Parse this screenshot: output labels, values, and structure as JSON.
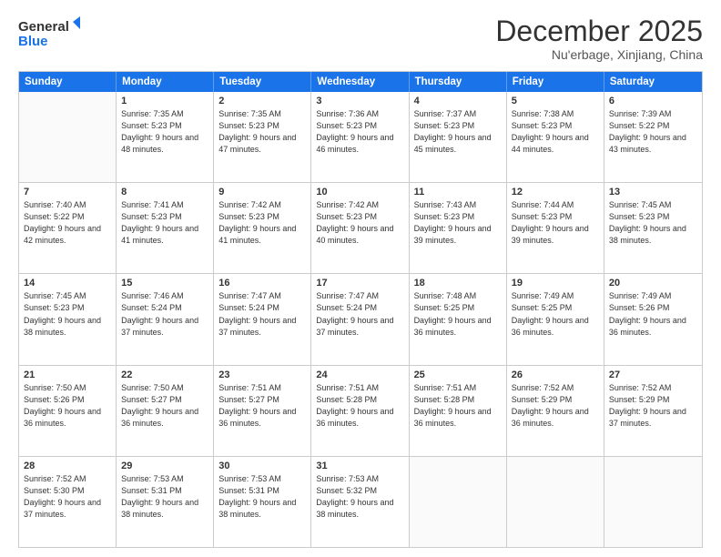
{
  "logo": {
    "line1": "General",
    "line2": "Blue"
  },
  "header": {
    "month": "December 2025",
    "location": "Nu'erbage, Xinjiang, China"
  },
  "weekdays": [
    "Sunday",
    "Monday",
    "Tuesday",
    "Wednesday",
    "Thursday",
    "Friday",
    "Saturday"
  ],
  "rows": [
    [
      {
        "day": "",
        "sunrise": "",
        "sunset": "",
        "daylight": ""
      },
      {
        "day": "1",
        "sunrise": "Sunrise: 7:35 AM",
        "sunset": "Sunset: 5:23 PM",
        "daylight": "Daylight: 9 hours and 48 minutes."
      },
      {
        "day": "2",
        "sunrise": "Sunrise: 7:35 AM",
        "sunset": "Sunset: 5:23 PM",
        "daylight": "Daylight: 9 hours and 47 minutes."
      },
      {
        "day": "3",
        "sunrise": "Sunrise: 7:36 AM",
        "sunset": "Sunset: 5:23 PM",
        "daylight": "Daylight: 9 hours and 46 minutes."
      },
      {
        "day": "4",
        "sunrise": "Sunrise: 7:37 AM",
        "sunset": "Sunset: 5:23 PM",
        "daylight": "Daylight: 9 hours and 45 minutes."
      },
      {
        "day": "5",
        "sunrise": "Sunrise: 7:38 AM",
        "sunset": "Sunset: 5:23 PM",
        "daylight": "Daylight: 9 hours and 44 minutes."
      },
      {
        "day": "6",
        "sunrise": "Sunrise: 7:39 AM",
        "sunset": "Sunset: 5:22 PM",
        "daylight": "Daylight: 9 hours and 43 minutes."
      }
    ],
    [
      {
        "day": "7",
        "sunrise": "Sunrise: 7:40 AM",
        "sunset": "Sunset: 5:22 PM",
        "daylight": "Daylight: 9 hours and 42 minutes."
      },
      {
        "day": "8",
        "sunrise": "Sunrise: 7:41 AM",
        "sunset": "Sunset: 5:23 PM",
        "daylight": "Daylight: 9 hours and 41 minutes."
      },
      {
        "day": "9",
        "sunrise": "Sunrise: 7:42 AM",
        "sunset": "Sunset: 5:23 PM",
        "daylight": "Daylight: 9 hours and 41 minutes."
      },
      {
        "day": "10",
        "sunrise": "Sunrise: 7:42 AM",
        "sunset": "Sunset: 5:23 PM",
        "daylight": "Daylight: 9 hours and 40 minutes."
      },
      {
        "day": "11",
        "sunrise": "Sunrise: 7:43 AM",
        "sunset": "Sunset: 5:23 PM",
        "daylight": "Daylight: 9 hours and 39 minutes."
      },
      {
        "day": "12",
        "sunrise": "Sunrise: 7:44 AM",
        "sunset": "Sunset: 5:23 PM",
        "daylight": "Daylight: 9 hours and 39 minutes."
      },
      {
        "day": "13",
        "sunrise": "Sunrise: 7:45 AM",
        "sunset": "Sunset: 5:23 PM",
        "daylight": "Daylight: 9 hours and 38 minutes."
      }
    ],
    [
      {
        "day": "14",
        "sunrise": "Sunrise: 7:45 AM",
        "sunset": "Sunset: 5:23 PM",
        "daylight": "Daylight: 9 hours and 38 minutes."
      },
      {
        "day": "15",
        "sunrise": "Sunrise: 7:46 AM",
        "sunset": "Sunset: 5:24 PM",
        "daylight": "Daylight: 9 hours and 37 minutes."
      },
      {
        "day": "16",
        "sunrise": "Sunrise: 7:47 AM",
        "sunset": "Sunset: 5:24 PM",
        "daylight": "Daylight: 9 hours and 37 minutes."
      },
      {
        "day": "17",
        "sunrise": "Sunrise: 7:47 AM",
        "sunset": "Sunset: 5:24 PM",
        "daylight": "Daylight: 9 hours and 37 minutes."
      },
      {
        "day": "18",
        "sunrise": "Sunrise: 7:48 AM",
        "sunset": "Sunset: 5:25 PM",
        "daylight": "Daylight: 9 hours and 36 minutes."
      },
      {
        "day": "19",
        "sunrise": "Sunrise: 7:49 AM",
        "sunset": "Sunset: 5:25 PM",
        "daylight": "Daylight: 9 hours and 36 minutes."
      },
      {
        "day": "20",
        "sunrise": "Sunrise: 7:49 AM",
        "sunset": "Sunset: 5:26 PM",
        "daylight": "Daylight: 9 hours and 36 minutes."
      }
    ],
    [
      {
        "day": "21",
        "sunrise": "Sunrise: 7:50 AM",
        "sunset": "Sunset: 5:26 PM",
        "daylight": "Daylight: 9 hours and 36 minutes."
      },
      {
        "day": "22",
        "sunrise": "Sunrise: 7:50 AM",
        "sunset": "Sunset: 5:27 PM",
        "daylight": "Daylight: 9 hours and 36 minutes."
      },
      {
        "day": "23",
        "sunrise": "Sunrise: 7:51 AM",
        "sunset": "Sunset: 5:27 PM",
        "daylight": "Daylight: 9 hours and 36 minutes."
      },
      {
        "day": "24",
        "sunrise": "Sunrise: 7:51 AM",
        "sunset": "Sunset: 5:28 PM",
        "daylight": "Daylight: 9 hours and 36 minutes."
      },
      {
        "day": "25",
        "sunrise": "Sunrise: 7:51 AM",
        "sunset": "Sunset: 5:28 PM",
        "daylight": "Daylight: 9 hours and 36 minutes."
      },
      {
        "day": "26",
        "sunrise": "Sunrise: 7:52 AM",
        "sunset": "Sunset: 5:29 PM",
        "daylight": "Daylight: 9 hours and 36 minutes."
      },
      {
        "day": "27",
        "sunrise": "Sunrise: 7:52 AM",
        "sunset": "Sunset: 5:29 PM",
        "daylight": "Daylight: 9 hours and 37 minutes."
      }
    ],
    [
      {
        "day": "28",
        "sunrise": "Sunrise: 7:52 AM",
        "sunset": "Sunset: 5:30 PM",
        "daylight": "Daylight: 9 hours and 37 minutes."
      },
      {
        "day": "29",
        "sunrise": "Sunrise: 7:53 AM",
        "sunset": "Sunset: 5:31 PM",
        "daylight": "Daylight: 9 hours and 38 minutes."
      },
      {
        "day": "30",
        "sunrise": "Sunrise: 7:53 AM",
        "sunset": "Sunset: 5:31 PM",
        "daylight": "Daylight: 9 hours and 38 minutes."
      },
      {
        "day": "31",
        "sunrise": "Sunrise: 7:53 AM",
        "sunset": "Sunset: 5:32 PM",
        "daylight": "Daylight: 9 hours and 38 minutes."
      },
      {
        "day": "",
        "sunrise": "",
        "sunset": "",
        "daylight": ""
      },
      {
        "day": "",
        "sunrise": "",
        "sunset": "",
        "daylight": ""
      },
      {
        "day": "",
        "sunrise": "",
        "sunset": "",
        "daylight": ""
      }
    ]
  ]
}
